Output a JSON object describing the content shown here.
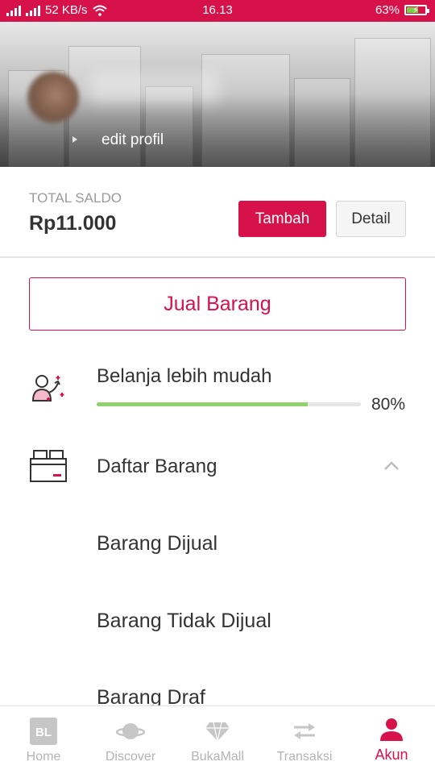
{
  "status_bar": {
    "network_speed": "52 KB/s",
    "time": "16.13",
    "battery_percent": "63%",
    "battery_level": 0.63
  },
  "profile": {
    "edit_label": "edit profil"
  },
  "balance": {
    "label": "TOTAL SALDO",
    "amount": "Rp11.000",
    "add_button": "Tambah",
    "detail_button": "Detail"
  },
  "sell_button": "Jual Barang",
  "shopping_progress": {
    "title": "Belanja lebih mudah",
    "percent_text": "80%",
    "value": 0.8
  },
  "product_list": {
    "title": "Daftar Barang",
    "items": [
      "Barang Dijual",
      "Barang Tidak Dijual",
      "Barang Draf"
    ]
  },
  "bottom_nav": {
    "items": [
      {
        "label": "Home",
        "icon": "bl-logo-icon"
      },
      {
        "label": "Discover",
        "icon": "planet-icon"
      },
      {
        "label": "BukaMall",
        "icon": "diamond-icon"
      },
      {
        "label": "Transaksi",
        "icon": "swap-arrows-icon"
      },
      {
        "label": "Akun",
        "icon": "user-icon"
      }
    ],
    "active": "Akun"
  },
  "colors": {
    "brand": "#d71149",
    "progress": "#8fd16b",
    "inactive_nav": "#b3b3b3"
  }
}
